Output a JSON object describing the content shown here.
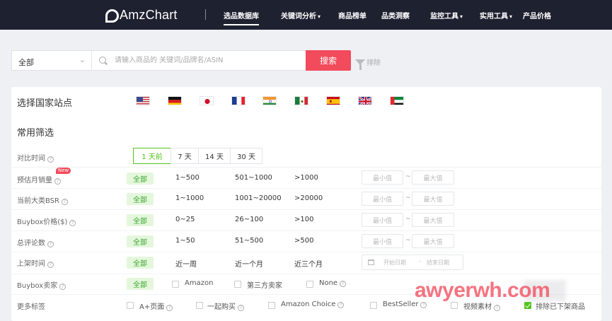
{
  "brand": {
    "name": "AmzChart"
  },
  "nav": {
    "items": [
      {
        "label": "选品数据库",
        "caret": ""
      },
      {
        "label": "关键词分析",
        "caret": "▾"
      },
      {
        "label": "商品榜单",
        "caret": ""
      },
      {
        "label": "品类洞察",
        "caret": ""
      },
      {
        "label": "监控工具",
        "caret": "▾"
      },
      {
        "label": "实用工具",
        "caret": "▾"
      },
      {
        "label": "产品价格",
        "caret": ""
      }
    ],
    "active": "选品数据库"
  },
  "search": {
    "category_value": "全部",
    "placeholder": "请输入商品的 关键词/品牌名/ASIN",
    "button_label": "搜索",
    "exclude_label": "排除"
  },
  "countries": {
    "title": "选择国家站点",
    "flags": [
      "US",
      "DE",
      "JP",
      "FR",
      "IN",
      "MX",
      "ES",
      "GB",
      "AE"
    ]
  },
  "filters": {
    "title": "常用筛选",
    "period": {
      "label": "对比时间",
      "options": [
        "1 天前",
        "7 天",
        "14 天",
        "30 天"
      ],
      "selected": "1 天前"
    },
    "badge_new": "New",
    "rows": [
      {
        "label": "预估月销量",
        "all": "全部",
        "options": [
          "1~500",
          "501~1000",
          ">1000"
        ],
        "min": "最小值",
        "max": "最大值"
      },
      {
        "label": "当前大类BSR",
        "all": "全部",
        "options": [
          "1~1000",
          "1001~20000",
          ">20000"
        ],
        "min": "最小值",
        "max": "最大值"
      },
      {
        "label": "Buybox价格($)",
        "all": "全部",
        "options": [
          "0~25",
          "26~100",
          ">100"
        ],
        "min": "最小值",
        "max": "最大值"
      },
      {
        "label": "总评论数",
        "all": "全部",
        "options": [
          "1~50",
          "51~500",
          ">500"
        ],
        "min": "最小值",
        "max": "最大值"
      }
    ],
    "listing": {
      "label": "上架时间",
      "all": "全部",
      "options": [
        "近一周",
        "近一个月",
        "近三个月"
      ],
      "start_placeholder": "开始日期",
      "end_placeholder": "结束日期",
      "separator": "-"
    },
    "seller": {
      "label": "Buybox卖家",
      "all": "全部",
      "options": [
        "Amazon",
        "第三方卖家",
        "None"
      ]
    },
    "tags": {
      "label": "更多标签",
      "options": [
        "A+页面",
        "一起购买",
        "Amazon Choice",
        "BestSeller",
        "视频素材",
        "排除已下架商品"
      ]
    }
  },
  "watermark": {
    "text": "awyerwh.com"
  },
  "colors": {
    "nav_bg": "#1e2130",
    "accent_red": "#f24b5c",
    "accent_green": "#52c41a"
  }
}
